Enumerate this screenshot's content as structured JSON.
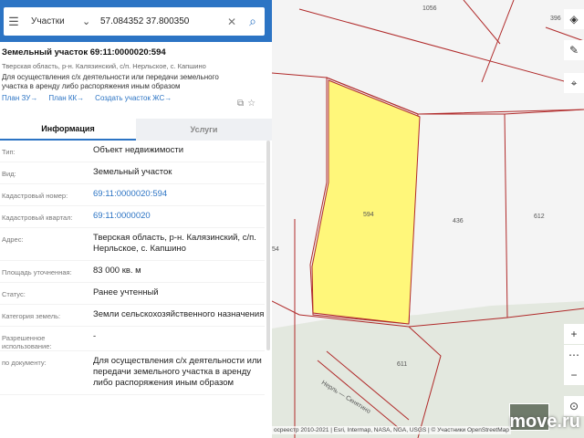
{
  "search": {
    "type": "Участки",
    "query": "57.084352 37.800350"
  },
  "parcel": {
    "title": "Земельный участок 69:11:0000020:594",
    "address_short": "Тверская область, р-н. Калязинский, с/п. Нерльское, с. Капшино",
    "purpose": "Для осуществления с/х деятельности или передачи земельного участка в аренду либо распоряжения иным образом"
  },
  "links": [
    "План ЗУ→",
    "План КК→",
    "Создать участок ЖС→"
  ],
  "tabs": {
    "info": "Информация",
    "services": "Услуги"
  },
  "rows": [
    {
      "label": "Тип:",
      "value": "Объект недвижимости"
    },
    {
      "label": "Вид:",
      "value": "Земельный участок"
    },
    {
      "label": "Кадастровый номер:",
      "value": "69:11:0000020:594"
    },
    {
      "label": "Кадастровый квартал:",
      "value": "69:11:0000020"
    },
    {
      "label": "Адрес:",
      "value": "Тверская область, р-н. Калязинский, с/п. Нерльское, с. Капшино"
    },
    {
      "label": "Площадь уточненная:",
      "value": "83 000 кв. м"
    },
    {
      "label": "Статус:",
      "value": "Ранее учтенный"
    },
    {
      "label": "Категория земель:",
      "value": "Земли сельскохозяйственного назначения"
    },
    {
      "label": "Разрешенное использование:",
      "value": "-"
    },
    {
      "label": "по документу:",
      "value": "Для осуществления с/х деятельности или передачи земельного участка в аренду либо распоряжения иным образом"
    }
  ],
  "map": {
    "parcel_labels": [
      "1056",
      "396",
      "594",
      "436",
      "612",
      "54",
      "611"
    ],
    "street": "Нерль — Скнятино",
    "attribution": "осреестр 2010-2021 | Esri, Intermap, NASA, NGA, USGS | © Участники OpenStreetMap",
    "watermark": "move.ru"
  },
  "colors": {
    "accent": "#2c74c4",
    "selected_parcel": "#fff77a",
    "parcel_border": "#b02a2a"
  }
}
